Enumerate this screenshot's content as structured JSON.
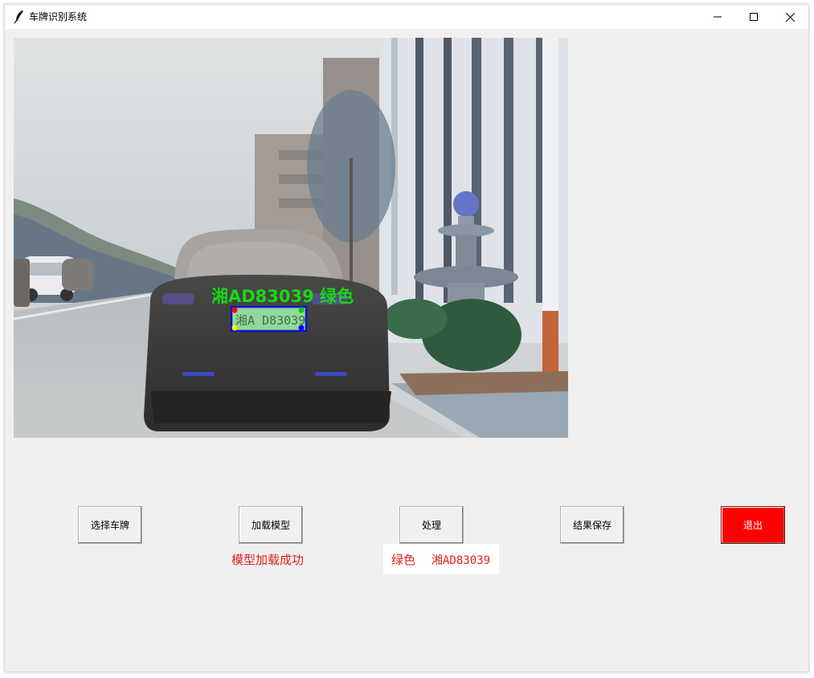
{
  "window": {
    "title": "车牌识别系统",
    "controls": {
      "minimize": "minimize-icon",
      "maximize": "maximize-icon",
      "close": "close-icon"
    }
  },
  "image_view": {
    "overlay_label": "湘AD83039 绿色",
    "plate_text": "湘A D83039",
    "colors": {
      "label": "#16d916",
      "box": "#1010d0",
      "plate_fill": "#8fd99a"
    }
  },
  "buttons": {
    "select": "选择车牌",
    "load_model": "加载模型",
    "process": "处理",
    "save": "结果保存",
    "exit": "退出"
  },
  "status": {
    "model_loaded": "模型加载成功",
    "plate_color": "绿色",
    "plate_number": "湘AD83039"
  },
  "colors": {
    "exit_bg": "#ff0000",
    "status_text": "#e02020"
  }
}
